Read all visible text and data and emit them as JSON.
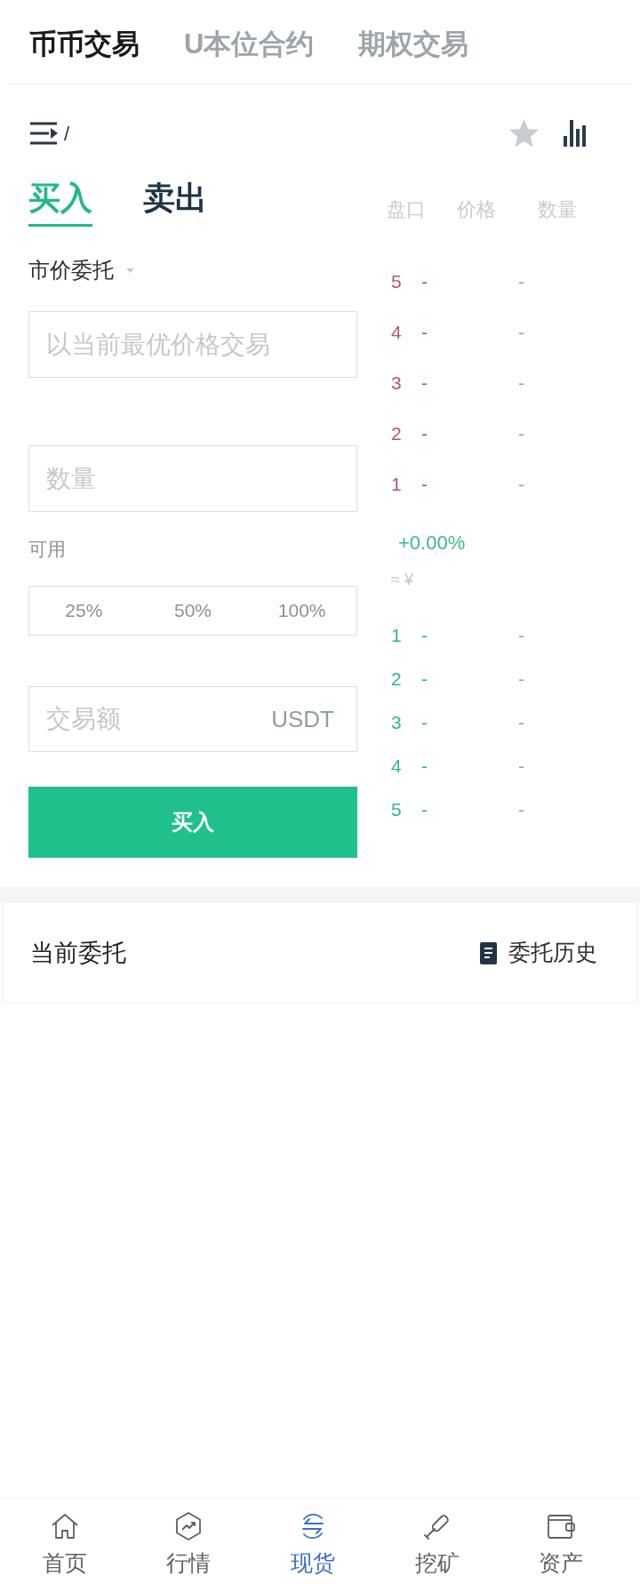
{
  "top_tabs": [
    {
      "label": "币币交易",
      "selected": true
    },
    {
      "label": "U本位合约",
      "selected": false
    },
    {
      "label": "期权交易",
      "selected": false
    }
  ],
  "toolbar": {
    "pair": "/",
    "starred": false
  },
  "trade_tabs": [
    {
      "label": "买入",
      "selected": true
    },
    {
      "label": "卖出",
      "selected": false
    }
  ],
  "order_form": {
    "order_type": "市价委托",
    "price_field": {
      "placeholder": "以当前最优价格交易"
    },
    "amount_field": {
      "placeholder": "数量"
    },
    "available_label": "可用",
    "percent_buttons": [
      "25%",
      "50%",
      "100%"
    ],
    "total_field": {
      "placeholder": "交易额",
      "unit": "USDT"
    },
    "submit_button": "买入"
  },
  "order_book": {
    "columns": [
      "盘口",
      "价格",
      "数量"
    ],
    "asks": [
      {
        "row": "5",
        "price": "-",
        "amount": "-"
      },
      {
        "row": "4",
        "price": "-",
        "amount": "-"
      },
      {
        "row": "3",
        "price": "-",
        "amount": "-"
      },
      {
        "row": "2",
        "price": "-",
        "amount": "-"
      },
      {
        "row": "1",
        "price": "-",
        "amount": "-"
      }
    ],
    "change": "+0.00%",
    "cny_price": "≈ ¥",
    "bids": [
      {
        "row": "1",
        "price": "-",
        "amount": "-"
      },
      {
        "row": "2",
        "price": "-",
        "amount": "-"
      },
      {
        "row": "3",
        "price": "-",
        "amount": "-"
      },
      {
        "row": "4",
        "price": "-",
        "amount": "-"
      },
      {
        "row": "5",
        "price": "-",
        "amount": "-"
      }
    ]
  },
  "open_orders": {
    "title": "当前委托",
    "history_link": "委托历史"
  },
  "bottom_nav": [
    {
      "kind": "home",
      "label": "首页",
      "selected": false
    },
    {
      "kind": "market",
      "label": "行情",
      "selected": false
    },
    {
      "kind": "spot",
      "label": "现货",
      "selected": true
    },
    {
      "kind": "mining",
      "label": "挖矿",
      "selected": false
    },
    {
      "kind": "assets",
      "label": "资产",
      "selected": false
    }
  ]
}
